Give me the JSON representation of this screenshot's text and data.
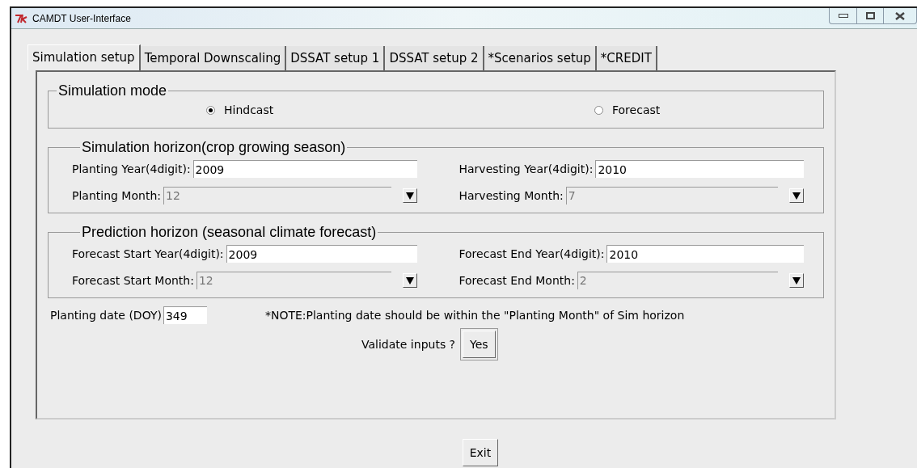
{
  "window": {
    "title": "CAMDT User-Interface"
  },
  "tabs": [
    {
      "label": "Simulation setup",
      "selected": true
    },
    {
      "label": "Temporal Downscaling",
      "selected": false
    },
    {
      "label": "DSSAT setup 1",
      "selected": false
    },
    {
      "label": "DSSAT setup 2",
      "selected": false
    },
    {
      "label": "*Scenarios setup",
      "selected": false
    },
    {
      "label": "*CREDIT",
      "selected": false
    }
  ],
  "simulation_mode": {
    "legend": "Simulation mode",
    "options": [
      {
        "label": "Hindcast",
        "selected": true
      },
      {
        "label": "Forecast",
        "selected": false
      }
    ]
  },
  "groups": [
    {
      "legend": "Simulation horizon(crop growing season)",
      "fields": [
        {
          "kind": "entry",
          "label": "Planting Year(4digit):",
          "value": "2009"
        },
        {
          "kind": "entry",
          "label": "Harvesting Year(4digit):",
          "value": "2010"
        },
        {
          "kind": "combo",
          "label": "Planting Month:",
          "value": "12"
        },
        {
          "kind": "combo",
          "label": "Harvesting Month:",
          "value": "7"
        }
      ]
    },
    {
      "legend": "Prediction horizon (seasonal climate forecast)",
      "fields": [
        {
          "kind": "entry",
          "label": "Forecast Start Year(4digit):",
          "value": "2009"
        },
        {
          "kind": "entry",
          "label": "Forecast End Year(4digit):",
          "value": "2010"
        },
        {
          "kind": "combo",
          "label": "Forecast Start Month:",
          "value": "12"
        },
        {
          "kind": "combo",
          "label": "Forecast End Month:",
          "value": "2"
        }
      ]
    }
  ],
  "planting_date": {
    "label": "Planting date (DOY)",
    "value": "349"
  },
  "note": "*NOTE:Planting date should be within the \"Planting Month\" of Sim horizon",
  "validate": {
    "label": "Validate inputs ?",
    "button": "Yes"
  },
  "exit_button": "Exit"
}
